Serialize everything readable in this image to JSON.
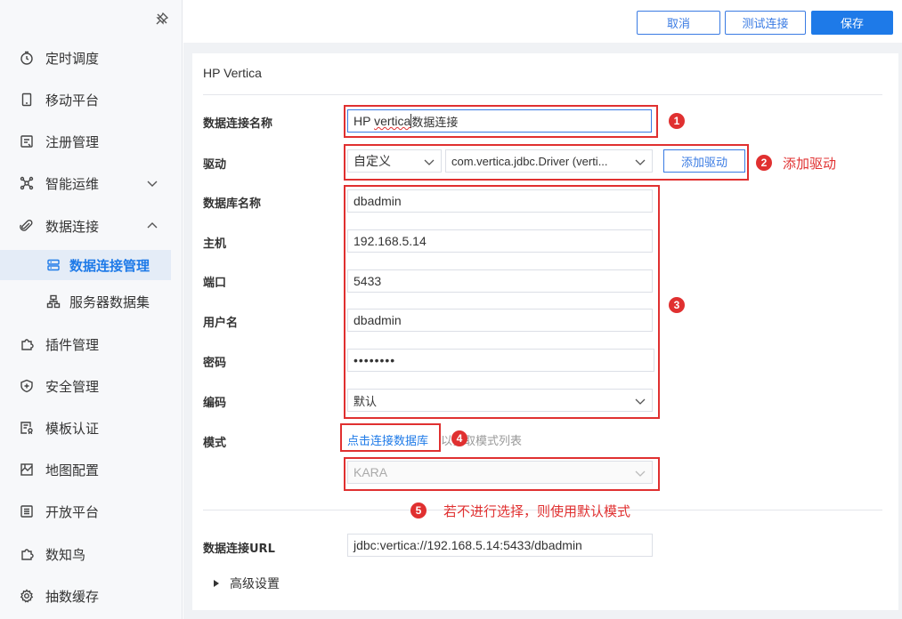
{
  "sidebar": {
    "items": [
      {
        "label": "定时调度",
        "icon": "clock-icon"
      },
      {
        "label": "移动平台",
        "icon": "mobile-icon"
      },
      {
        "label": "注册管理",
        "icon": "register-icon"
      },
      {
        "label": "智能运维",
        "icon": "ops-icon"
      },
      {
        "label": "数据连接",
        "icon": "link-icon"
      },
      {
        "label": "插件管理",
        "icon": "plugin-icon"
      },
      {
        "label": "安全管理",
        "icon": "shield-icon"
      },
      {
        "label": "模板认证",
        "icon": "template-icon"
      },
      {
        "label": "地图配置",
        "icon": "map-icon"
      },
      {
        "label": "开放平台",
        "icon": "list-icon"
      },
      {
        "label": "数知鸟",
        "icon": "puzzle-icon"
      },
      {
        "label": "抽数缓存",
        "icon": "gear-icon"
      }
    ],
    "subitems": [
      {
        "label": "数据连接管理",
        "icon": "database-icon"
      },
      {
        "label": "服务器数据集",
        "icon": "dataset-icon"
      }
    ]
  },
  "toolbar": {
    "cancel_label": "取消",
    "test_label": "测试连接",
    "save_label": "保存"
  },
  "form": {
    "title": "HP Vertica",
    "name_label": "数据连接名称",
    "name_value_part1": "HP ",
    "name_value_part2": "vertica",
    "name_value_part3": "数据连接",
    "driver_label": "驱动",
    "driver_type": "自定义",
    "driver_class": "com.vertica.jdbc.Driver (verti...",
    "add_driver_label": "添加驱动",
    "db_label": "数据库名称",
    "db_value": "dbadmin",
    "host_label": "主机",
    "host_value": "192.168.5.14",
    "port_label": "端口",
    "port_value": "5433",
    "user_label": "用户名",
    "user_value": "dbadmin",
    "password_label": "密码",
    "password_value": "••••••••",
    "encoding_label": "编码",
    "encoding_value": "默认",
    "schema_label": "模式",
    "schema_link": "点击连接数据库",
    "schema_hint": "以获取模式列表",
    "schema_value": "KARA",
    "url_label": "数据连接URL",
    "url_value": "jdbc:vertica://192.168.5.14:5433/dbadmin",
    "advanced_label": "高级设置"
  },
  "annotations": {
    "n1": "1",
    "n2": "2",
    "n3": "3",
    "n4": "4",
    "n5": "5",
    "add_driver_note": "添加驱动",
    "default_schema_note": "若不进行选择，则使用默认模式",
    "color": "#e03030"
  }
}
